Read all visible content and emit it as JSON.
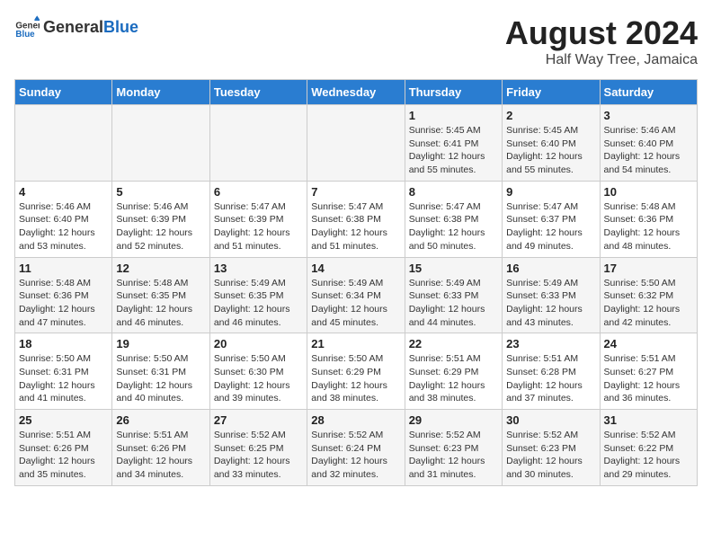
{
  "header": {
    "logo_general": "General",
    "logo_blue": "Blue",
    "main_title": "August 2024",
    "sub_title": "Half Way Tree, Jamaica"
  },
  "days_of_week": [
    "Sunday",
    "Monday",
    "Tuesday",
    "Wednesday",
    "Thursday",
    "Friday",
    "Saturday"
  ],
  "weeks": [
    [
      {
        "day": "",
        "info": ""
      },
      {
        "day": "",
        "info": ""
      },
      {
        "day": "",
        "info": ""
      },
      {
        "day": "",
        "info": ""
      },
      {
        "day": "1",
        "info": "Sunrise: 5:45 AM\nSunset: 6:41 PM\nDaylight: 12 hours and 55 minutes."
      },
      {
        "day": "2",
        "info": "Sunrise: 5:45 AM\nSunset: 6:40 PM\nDaylight: 12 hours and 55 minutes."
      },
      {
        "day": "3",
        "info": "Sunrise: 5:46 AM\nSunset: 6:40 PM\nDaylight: 12 hours and 54 minutes."
      }
    ],
    [
      {
        "day": "4",
        "info": "Sunrise: 5:46 AM\nSunset: 6:40 PM\nDaylight: 12 hours and 53 minutes."
      },
      {
        "day": "5",
        "info": "Sunrise: 5:46 AM\nSunset: 6:39 PM\nDaylight: 12 hours and 52 minutes."
      },
      {
        "day": "6",
        "info": "Sunrise: 5:47 AM\nSunset: 6:39 PM\nDaylight: 12 hours and 51 minutes."
      },
      {
        "day": "7",
        "info": "Sunrise: 5:47 AM\nSunset: 6:38 PM\nDaylight: 12 hours and 51 minutes."
      },
      {
        "day": "8",
        "info": "Sunrise: 5:47 AM\nSunset: 6:38 PM\nDaylight: 12 hours and 50 minutes."
      },
      {
        "day": "9",
        "info": "Sunrise: 5:47 AM\nSunset: 6:37 PM\nDaylight: 12 hours and 49 minutes."
      },
      {
        "day": "10",
        "info": "Sunrise: 5:48 AM\nSunset: 6:36 PM\nDaylight: 12 hours and 48 minutes."
      }
    ],
    [
      {
        "day": "11",
        "info": "Sunrise: 5:48 AM\nSunset: 6:36 PM\nDaylight: 12 hours and 47 minutes."
      },
      {
        "day": "12",
        "info": "Sunrise: 5:48 AM\nSunset: 6:35 PM\nDaylight: 12 hours and 46 minutes."
      },
      {
        "day": "13",
        "info": "Sunrise: 5:49 AM\nSunset: 6:35 PM\nDaylight: 12 hours and 46 minutes."
      },
      {
        "day": "14",
        "info": "Sunrise: 5:49 AM\nSunset: 6:34 PM\nDaylight: 12 hours and 45 minutes."
      },
      {
        "day": "15",
        "info": "Sunrise: 5:49 AM\nSunset: 6:33 PM\nDaylight: 12 hours and 44 minutes."
      },
      {
        "day": "16",
        "info": "Sunrise: 5:49 AM\nSunset: 6:33 PM\nDaylight: 12 hours and 43 minutes."
      },
      {
        "day": "17",
        "info": "Sunrise: 5:50 AM\nSunset: 6:32 PM\nDaylight: 12 hours and 42 minutes."
      }
    ],
    [
      {
        "day": "18",
        "info": "Sunrise: 5:50 AM\nSunset: 6:31 PM\nDaylight: 12 hours and 41 minutes."
      },
      {
        "day": "19",
        "info": "Sunrise: 5:50 AM\nSunset: 6:31 PM\nDaylight: 12 hours and 40 minutes."
      },
      {
        "day": "20",
        "info": "Sunrise: 5:50 AM\nSunset: 6:30 PM\nDaylight: 12 hours and 39 minutes."
      },
      {
        "day": "21",
        "info": "Sunrise: 5:50 AM\nSunset: 6:29 PM\nDaylight: 12 hours and 38 minutes."
      },
      {
        "day": "22",
        "info": "Sunrise: 5:51 AM\nSunset: 6:29 PM\nDaylight: 12 hours and 38 minutes."
      },
      {
        "day": "23",
        "info": "Sunrise: 5:51 AM\nSunset: 6:28 PM\nDaylight: 12 hours and 37 minutes."
      },
      {
        "day": "24",
        "info": "Sunrise: 5:51 AM\nSunset: 6:27 PM\nDaylight: 12 hours and 36 minutes."
      }
    ],
    [
      {
        "day": "25",
        "info": "Sunrise: 5:51 AM\nSunset: 6:26 PM\nDaylight: 12 hours and 35 minutes."
      },
      {
        "day": "26",
        "info": "Sunrise: 5:51 AM\nSunset: 6:26 PM\nDaylight: 12 hours and 34 minutes."
      },
      {
        "day": "27",
        "info": "Sunrise: 5:52 AM\nSunset: 6:25 PM\nDaylight: 12 hours and 33 minutes."
      },
      {
        "day": "28",
        "info": "Sunrise: 5:52 AM\nSunset: 6:24 PM\nDaylight: 12 hours and 32 minutes."
      },
      {
        "day": "29",
        "info": "Sunrise: 5:52 AM\nSunset: 6:23 PM\nDaylight: 12 hours and 31 minutes."
      },
      {
        "day": "30",
        "info": "Sunrise: 5:52 AM\nSunset: 6:23 PM\nDaylight: 12 hours and 30 minutes."
      },
      {
        "day": "31",
        "info": "Sunrise: 5:52 AM\nSunset: 6:22 PM\nDaylight: 12 hours and 29 minutes."
      }
    ]
  ]
}
